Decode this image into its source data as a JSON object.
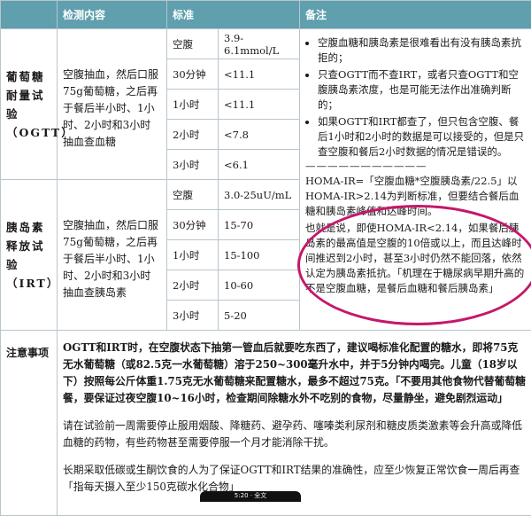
{
  "header": {
    "col1": "",
    "col2": "检测内容",
    "col3": "标准",
    "col4": "备注"
  },
  "ogtt": {
    "category": "葡萄糖耐量试验（OGTT）",
    "content": "空腹抽血，然后口服75g葡萄糖，之后再于餐后半小时、1小时、2小时和3小时抽血查血糖",
    "rows": [
      {
        "time": "空腹",
        "value": "3.9-6.1mmol/L"
      },
      {
        "time": "30分钟",
        "value": "<11.1"
      },
      {
        "time": "1小时",
        "value": "<11.1"
      },
      {
        "time": "2小时",
        "value": "<7.8"
      },
      {
        "time": "3小时",
        "value": "<6.1"
      }
    ]
  },
  "irt": {
    "category": "胰岛素释放试验（IRT）",
    "content": "空腹抽血，然后口服75g葡萄糖，之后再于餐后半小时、1小时、2小时和3小时抽血查胰岛素",
    "rows": [
      {
        "time": "空腹",
        "value": "3.0-25uU/mL"
      },
      {
        "time": "30分钟",
        "value": "15-70"
      },
      {
        "time": "1小时",
        "value": "15-100"
      },
      {
        "time": "2小时",
        "value": "10-60"
      },
      {
        "time": "3小时",
        "value": "5-20"
      }
    ]
  },
  "notes": {
    "bullets": [
      "空腹血糖和胰岛素是很难看出有没有胰岛素抗拒的；",
      "只查OGTT而不查IRT，或者只查OGTT和空腹胰岛素浓度，也是可能无法作出准确判断的；",
      "如果OGTT和IRT都查了，但只包含空腹、餐后1小时和2小时的数据是可以接受的，但是只查空腹和餐后2小时数据的情况是错误的。"
    ],
    "divider": "———————————",
    "homa1": "HOMA-IR=「空腹血糖*空腹胰岛素/22.5」以HOMA-IR>2.14为判断标准，但要结合餐后血糖和胰岛素峰值和达峰时间。",
    "homa2": "也就是说，即使HOMA-IR<2.14，如果餐后胰岛素的最高值是空腹的10倍或以上，而且达峰时间推迟到2小时，甚至3小时仍然不能回落，依然认定为胰岛素抵抗。「机理在于糖尿病早期升高的不是空腹血糖，是餐后血糖和餐后胰岛素」"
  },
  "attention": {
    "label": "注意事项",
    "p1": "OGTT和IRT时，在空腹状态下抽第一管血后就要吃东西了，建议喝标准化配置的糖水，即将75克无水葡萄糖（或82.5克一水葡萄糖）溶于250~300毫升水中，并于5分钟内喝完。儿童（18岁以下）按照每公斤体重1.75克无水葡萄糖来配置糖水，最多不超过75克。「不要用其他食物代替葡萄糖餐，要保证过夜空腹10~16小时，检查期间除糖水外不吃别的食物，尽量静坐，避免剧烈运动」",
    "p2": "请在试验前一周需要停止服用烟酸、降糖药、避孕药、噻嗪类利尿剂和糖皮质类激素等会升高或降低血糖的药物，有些药物甚至需要停服一个月才能消除干扰。",
    "p3": "长期采取低碳或生酮饮食的人为了保证OGTT和IRT结果的准确性，应至少恢复正常饮食一周后再查「指每天摄入至少150克碳水化合物」"
  },
  "status_bar": {
    "text": "5:20 · 全文"
  },
  "colors": {
    "header_bg": "#5f9fae",
    "highlight_circle": "#c4186a"
  }
}
